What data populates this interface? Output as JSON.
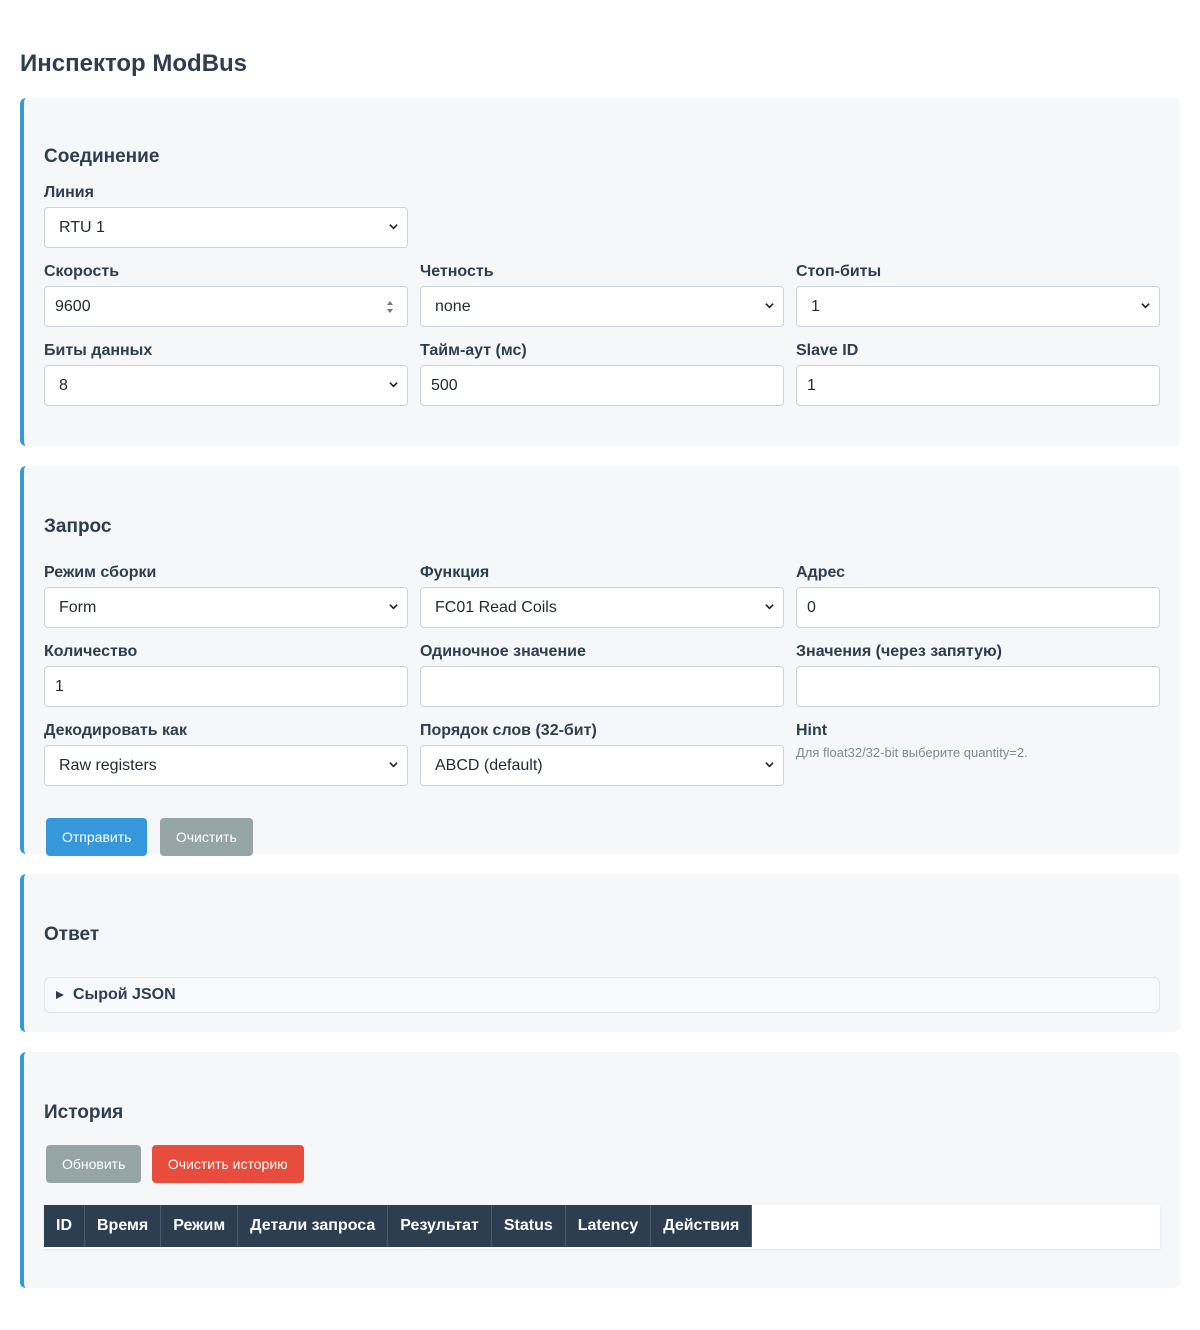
{
  "page": {
    "title": "Инспектор ModBus"
  },
  "connection": {
    "title": "Соединение",
    "line": {
      "label": "Линия",
      "value": "RTU 1"
    },
    "speed": {
      "label": "Скорость",
      "value": "9600"
    },
    "parity": {
      "label": "Четность",
      "value": "none"
    },
    "stop_bits": {
      "label": "Стоп-биты",
      "value": "1"
    },
    "data_bits": {
      "label": "Биты данных",
      "value": "8"
    },
    "timeout": {
      "label": "Тайм-аут (мс)",
      "value": "500"
    },
    "slave_id": {
      "label": "Slave ID",
      "value": "1"
    }
  },
  "request": {
    "title": "Запрос",
    "build_mode": {
      "label": "Режим сборки",
      "value": "Form"
    },
    "function": {
      "label": "Функция",
      "value": "FC01 Read Coils"
    },
    "address": {
      "label": "Адрес",
      "value": "0"
    },
    "quantity": {
      "label": "Количество",
      "value": "1"
    },
    "single_value": {
      "label": "Одиночное значение",
      "value": ""
    },
    "values": {
      "label": "Значения (через запятую)",
      "value": ""
    },
    "decode_as": {
      "label": "Декодировать как",
      "value": "Raw registers"
    },
    "word_order": {
      "label": "Порядок слов (32-бит)",
      "value": "ABCD (default)"
    },
    "hint": {
      "label": "Hint",
      "text": "Для float32/32-bit выберите quantity=2."
    },
    "send_label": "Отправить",
    "clear_label": "Очистить"
  },
  "response": {
    "title": "Ответ",
    "raw_json_label": "Сырой JSON"
  },
  "history": {
    "title": "История",
    "refresh_label": "Обновить",
    "clear_label": "Очистить историю",
    "columns": [
      "ID",
      "Время",
      "Режим",
      "Детали запроса",
      "Результат",
      "Status",
      "Latency",
      "Действия"
    ]
  },
  "colors": {
    "accent": "#3498db",
    "header_dark": "#2c3e50",
    "danger": "#e74c3c",
    "neutral_button": "#95a5a6"
  },
  "icons": [
    "chevron-down-icon",
    "spinner-arrows-icon",
    "disclosure-triangle-icon"
  ]
}
